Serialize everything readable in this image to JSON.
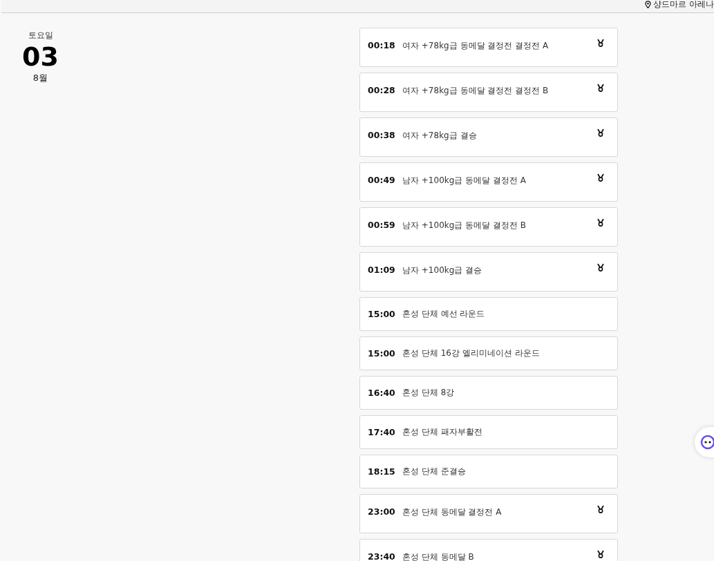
{
  "venue": "샹드마르 아레나",
  "date": {
    "weekday": "토요일",
    "day": "03",
    "month": "8월"
  },
  "events": [
    {
      "time": "00:18",
      "title": "여자 +78kg급 동메달 결정전 결정전 A",
      "medal": true
    },
    {
      "time": "00:28",
      "title": "여자 +78kg급 동메달 결정전 결정전 B",
      "medal": true
    },
    {
      "time": "00:38",
      "title": "여자 +78kg급 결승",
      "medal": true
    },
    {
      "time": "00:49",
      "title": "남자 +100kg급 동메달 결정전 A",
      "medal": true
    },
    {
      "time": "00:59",
      "title": "남자 +100kg급 동메달 결정전 B",
      "medal": true
    },
    {
      "time": "01:09",
      "title": "남자 +100kg급 결승",
      "medal": true
    },
    {
      "time": "15:00",
      "title": "혼성 단체 예선 라운드",
      "medal": false
    },
    {
      "time": "15:00",
      "title": "혼성 단체 16강 엘리미네이션 라운드",
      "medal": false
    },
    {
      "time": "16:40",
      "title": "혼성 단체 8강",
      "medal": false
    },
    {
      "time": "17:40",
      "title": "혼성 단체 패자부활전",
      "medal": false
    },
    {
      "time": "18:15",
      "title": "혼성 단체 준결승",
      "medal": false
    },
    {
      "time": "23:00",
      "title": "혼성 단체 동메달 결정전 A",
      "medal": true
    },
    {
      "time": "23:40",
      "title": "혼성 단체 동메달 B",
      "medal": true
    }
  ]
}
